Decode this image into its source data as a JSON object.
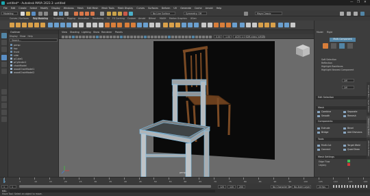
{
  "window": {
    "title": "untitled* - Autodesk MAYA 2023.3: untitled",
    "controls": [
      "—",
      "❐",
      "✕"
    ]
  },
  "menubar": {
    "items": [
      "File",
      "Edit",
      "Create",
      "Select",
      "Modify",
      "Display",
      "Windows",
      "Mesh",
      "Edit Mesh",
      "Mesh Tools",
      "Mesh Display",
      "Curves",
      "Surfaces",
      "Deform",
      "UV",
      "Generate",
      "Cache",
      "Arnold",
      "Help"
    ]
  },
  "statusline": {
    "mode": "Modeling",
    "symmetry": "Symmetry: Off",
    "no_live": "No Live Surface",
    "workspace": "Maya Classic",
    "search_placeholder": ""
  },
  "shelf_tabs": [
    "Curves / Surfaces",
    "Poly Modeling",
    "Sculpting",
    "Rigging",
    "Animation",
    "Rendering",
    "FX",
    "FX Caching",
    "Custom",
    "Arnold",
    "Bifrost",
    "MASH",
    "Motion Graphics",
    "XGen"
  ],
  "outliner": {
    "title": "Outliner",
    "menu": [
      "Display",
      "Show",
      "Help"
    ],
    "search": "Search...",
    "items": [
      "persp",
      "top",
      "front",
      "side",
      "pCube1",
      "pCylinder1",
      "chairModel",
      "woodChairModel1",
      "woodChairModel2"
    ]
  },
  "viewport": {
    "menu": [
      "View",
      "Shading",
      "Lighting",
      "Show",
      "Renderer",
      "Panels"
    ],
    "camera_field": "0.00",
    "zoom_field": "1.00",
    "colorspace": "ACES 1.0 SDR-video (sRGB)",
    "camera_label": "persp"
  },
  "right_panel": {
    "tabs": [
      "Model",
      "Rigid"
    ],
    "active_button": "Multi-Component",
    "checks": [
      "Soft Selection",
      "Reflection",
      "Highlight Backfaces",
      "Highlight Nearest Component"
    ],
    "reflection_axis": "Off",
    "falloff": "Off",
    "sections": [
      "Edit Selection",
      "Mesh",
      "Components",
      "Tools",
      "Mesh Settings"
    ],
    "mesh_buttons": [
      "Combine",
      "Separate",
      "Smooth",
      "Remesh"
    ],
    "component_buttons": [
      "Extrude",
      "Bevel",
      "Bridge",
      "Add Divisions"
    ],
    "tool_buttons": [
      "Multi-Cut",
      "Target Weld",
      "Connect",
      "Quad Draw"
    ],
    "setting_labels": [
      "Edge Flow",
      "Legacy"
    ],
    "side_tabs": [
      "Channel Box / Layer Editor",
      "Modeling Toolkit",
      "Attribute Editor"
    ]
  },
  "timeslider": {
    "ticks": [
      "1",
      "5",
      "10",
      "15",
      "20",
      "25",
      "30",
      "35",
      "40",
      "45",
      "50",
      "55",
      "60",
      "65",
      "70",
      "75",
      "80",
      "85",
      "90",
      "95",
      "100",
      "105",
      "110",
      "115",
      "120"
    ],
    "current": "1"
  },
  "rangebar": {
    "start": "1",
    "start2": "1",
    "end": "120",
    "end2": "120",
    "end3": "200",
    "fps": "24 fps",
    "character": "No Character Set",
    "anim_layer": "No Anim Layer"
  },
  "cmdline": {
    "label": "MEL"
  },
  "helpline": {
    "text": "Move Tool: Select an object to move."
  },
  "colors": {
    "accent": "#5285a6",
    "vp_bg": "#6b6b6b",
    "backdrop": "#0a0a0a",
    "mesh_wire": "#77c1ee"
  }
}
